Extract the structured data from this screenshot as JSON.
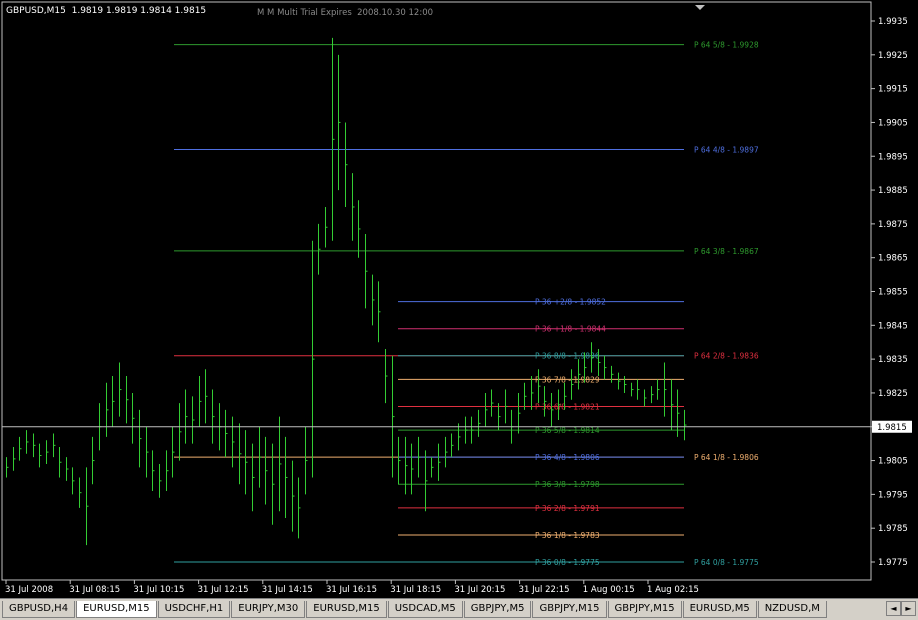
{
  "chart": {
    "symbol_info": "GBPUSD,M15  1.9819 1.9819 1.9814 1.9815",
    "trial_text": "M M Multi Trial Expires  2008.10.30 12:00",
    "current_price": "1.9815",
    "price_axis": [
      "1.9935",
      "1.9925",
      "1.9915",
      "1.9905",
      "1.9895",
      "1.9885",
      "1.9875",
      "1.9865",
      "1.9855",
      "1.9845",
      "1.9835",
      "1.9825",
      "1.9815",
      "1.9805",
      "1.9795",
      "1.9785",
      "1.9775"
    ],
    "time_axis": [
      "31 Jul 2008",
      "31 Jul 08:15",
      "31 Jul 10:15",
      "31 Jul 12:15",
      "31 Jul 14:15",
      "31 Jul 16:15",
      "31 Jul 18:15",
      "31 Jul 20:15",
      "31 Jul 22:15",
      "1 Aug 00:15",
      "1 Aug 02:15"
    ],
    "levels_p64": [
      {
        "label": "P 64 5/8  - 1.9928",
        "value": 1.9928,
        "color": "#2e9a2e"
      },
      {
        "label": "P 64 4/8  - 1.9897",
        "value": 1.9897,
        "color": "#4f6fe0"
      },
      {
        "label": "P 64 3/8  - 1.9867",
        "value": 1.9867,
        "color": "#2e9a2e"
      },
      {
        "label": "P 64 2/8  - 1.9836",
        "value": 1.9836,
        "color": "#e03040"
      },
      {
        "label": "P 64 1/8  - 1.9806",
        "value": 1.9806,
        "color": "#f0b070"
      },
      {
        "label": "P 64 0/8  - 1.9775",
        "value": 1.9775,
        "color": "#30a0a0"
      }
    ],
    "levels_p36": [
      {
        "label": "P 36 +2/8  - 1.9852",
        "value": 1.9852,
        "color": "#4f6fe0"
      },
      {
        "label": "P 36 +1/8  - 1.9844",
        "value": 1.9844,
        "color": "#d03070"
      },
      {
        "label": "P 36 8/8  - 1.9836",
        "value": 1.9836,
        "color": "#30a0a0"
      },
      {
        "label": "P 36 7/8  - 1.9829",
        "value": 1.9829,
        "color": "#f0b070"
      },
      {
        "label": "P 36 6/8  - 1.9821",
        "value": 1.9821,
        "color": "#e03040"
      },
      {
        "label": "P 36 5/8  - 1.9814",
        "value": 1.9814,
        "color": "#2e9a2e"
      },
      {
        "label": "P 36 4/8  - 1.9806",
        "value": 1.9806,
        "color": "#4f6fe0"
      },
      {
        "label": "P 36 3/8  - 1.9798",
        "value": 1.9798,
        "color": "#2e9a2e"
      },
      {
        "label": "P 36 2/8  - 1.9791",
        "value": 1.9791,
        "color": "#e03040"
      },
      {
        "label": "P 36 1/8  - 1.9783",
        "value": 1.9783,
        "color": "#f0b070"
      },
      {
        "label": "P 36 0/8  - 1.9775",
        "value": 1.9775,
        "color": "#30a0a0"
      }
    ],
    "bars": [
      [
        1.9806,
        1.98
      ],
      [
        1.9809,
        1.9802
      ],
      [
        1.9812,
        1.9805
      ],
      [
        1.9814,
        1.9807
      ],
      [
        1.9813,
        1.9806
      ],
      [
        1.981,
        1.9803
      ],
      [
        1.9811,
        1.9804
      ],
      [
        1.9813,
        1.9806
      ],
      [
        1.9809,
        1.98
      ],
      [
        1.9806,
        1.9799
      ],
      [
        1.9803,
        1.9795
      ],
      [
        1.98,
        1.9791
      ],
      [
        1.9803,
        1.978
      ],
      [
        1.9812,
        1.9798
      ],
      [
        1.9822,
        1.9808
      ],
      [
        1.9828,
        1.9812
      ],
      [
        1.983,
        1.9815
      ],
      [
        1.9834,
        1.9818
      ],
      [
        1.983,
        1.9816
      ],
      [
        1.9825,
        1.981
      ],
      [
        1.982,
        1.9803
      ],
      [
        1.9815,
        1.98
      ],
      [
        1.9808,
        1.9796
      ],
      [
        1.9804,
        1.9794
      ],
      [
        1.9808,
        1.9796
      ],
      [
        1.9815,
        1.98
      ],
      [
        1.9822,
        1.9805
      ],
      [
        1.9826,
        1.981
      ],
      [
        1.9824,
        1.981
      ],
      [
        1.983,
        1.9815
      ],
      [
        1.9832,
        1.9816
      ],
      [
        1.9826,
        1.981
      ],
      [
        1.9822,
        1.9808
      ],
      [
        1.982,
        1.9806
      ],
      [
        1.9818,
        1.9803
      ],
      [
        1.9816,
        1.9798
      ],
      [
        1.9814,
        1.9795
      ],
      [
        1.981,
        1.979
      ],
      [
        1.9815,
        1.9797
      ],
      [
        1.9812,
        1.9792
      ],
      [
        1.981,
        1.9786
      ],
      [
        1.9818,
        1.979
      ],
      [
        1.9812,
        1.9788
      ],
      [
        1.9805,
        1.9784
      ],
      [
        1.98,
        1.9782
      ],
      [
        1.9815,
        1.9795
      ],
      [
        1.987,
        1.98
      ],
      [
        1.9875,
        1.986
      ],
      [
        1.988,
        1.9868
      ],
      [
        1.993,
        1.987
      ],
      [
        1.9925,
        1.9885
      ],
      [
        1.9905,
        1.988
      ],
      [
        1.989,
        1.987
      ],
      [
        1.9882,
        1.9865
      ],
      [
        1.9872,
        1.985
      ],
      [
        1.986,
        1.9845
      ],
      [
        1.9858,
        1.984
      ],
      [
        1.9838,
        1.9822
      ],
      [
        1.9836,
        1.98
      ],
      [
        1.9812,
        1.9798
      ],
      [
        1.9812,
        1.9795
      ],
      [
        1.981,
        1.9795
      ],
      [
        1.9812,
        1.98
      ],
      [
        1.9808,
        1.979
      ],
      [
        1.9806,
        1.98
      ],
      [
        1.981,
        1.9799
      ],
      [
        1.9812,
        1.9803
      ],
      [
        1.9813,
        1.9806
      ],
      [
        1.9816,
        1.9808
      ],
      [
        1.9818,
        1.981
      ],
      [
        1.9818,
        1.981
      ],
      [
        1.982,
        1.9812
      ],
      [
        1.9825,
        1.9815
      ],
      [
        1.9826,
        1.9818
      ],
      [
        1.9822,
        1.9814
      ],
      [
        1.9826,
        1.9816
      ],
      [
        1.982,
        1.981
      ],
      [
        1.9825,
        1.9813
      ],
      [
        1.9828,
        1.982
      ],
      [
        1.983,
        1.982
      ],
      [
        1.9832,
        1.9822
      ],
      [
        1.9827,
        1.9818
      ],
      [
        1.9825,
        1.9815
      ],
      [
        1.9826,
        1.9817
      ],
      [
        1.9828,
        1.982
      ],
      [
        1.9832,
        1.9823
      ],
      [
        1.9835,
        1.9826
      ],
      [
        1.9837,
        1.9828
      ],
      [
        1.984,
        1.9831
      ],
      [
        1.9838,
        1.983
      ],
      [
        1.9836,
        1.9829
      ],
      [
        1.9833,
        1.9828
      ],
      [
        1.9831,
        1.9826
      ],
      [
        1.983,
        1.9825
      ],
      [
        1.9828,
        1.9824
      ],
      [
        1.9829,
        1.9823
      ],
      [
        1.9826,
        1.9821
      ],
      [
        1.9827,
        1.9822
      ],
      [
        1.9829,
        1.9823
      ],
      [
        1.9834,
        1.9818
      ],
      [
        1.9829,
        1.9814
      ],
      [
        1.9826,
        1.9812
      ],
      [
        1.982,
        1.9811
      ]
    ]
  },
  "tabs": [
    "GBPUSD,H4",
    "EURUSD,M15",
    "USDCHF,H1",
    "EURJPY,M30",
    "EURUSD,M15",
    "USDCAD,M5",
    "GBPJPY,M5",
    "GBPJPY,M15",
    "GBPJPY,M15",
    "EURUSD,M5",
    "NZDUSD,M"
  ],
  "active_tab": 1,
  "scroll_left_glyph": "◄",
  "scroll_right_glyph": "►"
}
